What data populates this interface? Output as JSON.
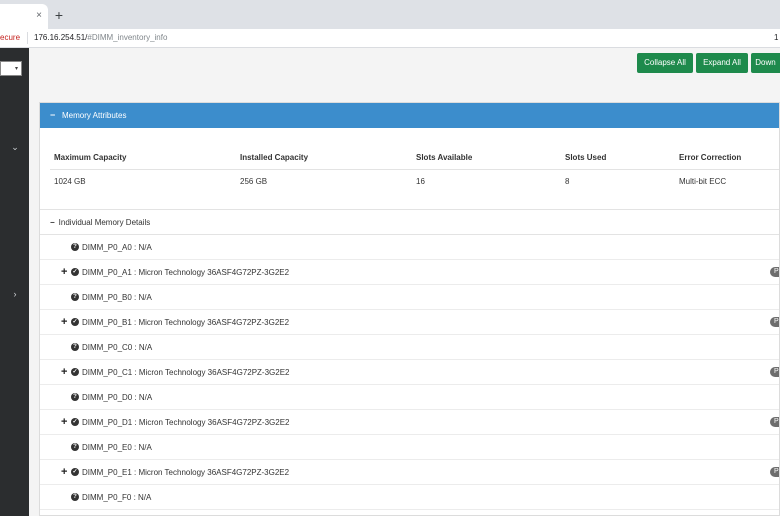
{
  "browser": {
    "tab_close": "×",
    "new_tab": "+",
    "secure_label": "ecure",
    "url_host": "176.16.254.51/",
    "url_path": "#DIMM_inventory_info",
    "right_glyph": "1"
  },
  "sidebar": {
    "select_caret": "▾",
    "chevron_down": "⌄",
    "chevron_right": "›"
  },
  "toolbar": {
    "collapse_all": "Collapse All",
    "expand_all": "Expand All",
    "download": "Down"
  },
  "panel": {
    "toggle": "−",
    "title": "Memory Attributes"
  },
  "attributes": {
    "headers": [
      "Maximum Capacity",
      "Installed Capacity",
      "Slots Available",
      "Slots Used",
      "Error Correction"
    ],
    "values": [
      "1024 GB",
      "256 GB",
      "16",
      "8",
      "Multi-bit ECC"
    ]
  },
  "individual": {
    "toggle": "−",
    "title": "Individual Memory Details"
  },
  "dimms": [
    {
      "label": "DIMM_P0_A0 : N/A",
      "status": "unknown",
      "icon": "?",
      "expandable": false
    },
    {
      "label": "DIMM_P0_A1 : Micron Technology 36ASF4G72PZ-3G2E2",
      "status": "ok",
      "icon": "✓",
      "expandable": true,
      "badge": "P"
    },
    {
      "label": "DIMM_P0_B0 : N/A",
      "status": "unknown",
      "icon": "?",
      "expandable": false
    },
    {
      "label": "DIMM_P0_B1 : Micron Technology 36ASF4G72PZ-3G2E2",
      "status": "ok",
      "icon": "✓",
      "expandable": true,
      "badge": "P"
    },
    {
      "label": "DIMM_P0_C0 : N/A",
      "status": "unknown",
      "icon": "?",
      "expandable": false
    },
    {
      "label": "DIMM_P0_C1 : Micron Technology 36ASF4G72PZ-3G2E2",
      "status": "ok",
      "icon": "✓",
      "expandable": true,
      "badge": "P"
    },
    {
      "label": "DIMM_P0_D0 : N/A",
      "status": "unknown",
      "icon": "?",
      "expandable": false
    },
    {
      "label": "DIMM_P0_D1 : Micron Technology 36ASF4G72PZ-3G2E2",
      "status": "ok",
      "icon": "✓",
      "expandable": true,
      "badge": "P"
    },
    {
      "label": "DIMM_P0_E0 : N/A",
      "status": "unknown",
      "icon": "?",
      "expandable": false
    },
    {
      "label": "DIMM_P0_E1 : Micron Technology 36ASF4G72PZ-3G2E2",
      "status": "ok",
      "icon": "✓",
      "expandable": true,
      "badge": "P"
    },
    {
      "label": "DIMM_P0_F0 : N/A",
      "status": "unknown",
      "icon": "?",
      "expandable": false
    }
  ],
  "colors": {
    "panel_header": "#3c8dcc",
    "button_green": "#1e8a4c",
    "sidebar": "#2b2d2f"
  }
}
